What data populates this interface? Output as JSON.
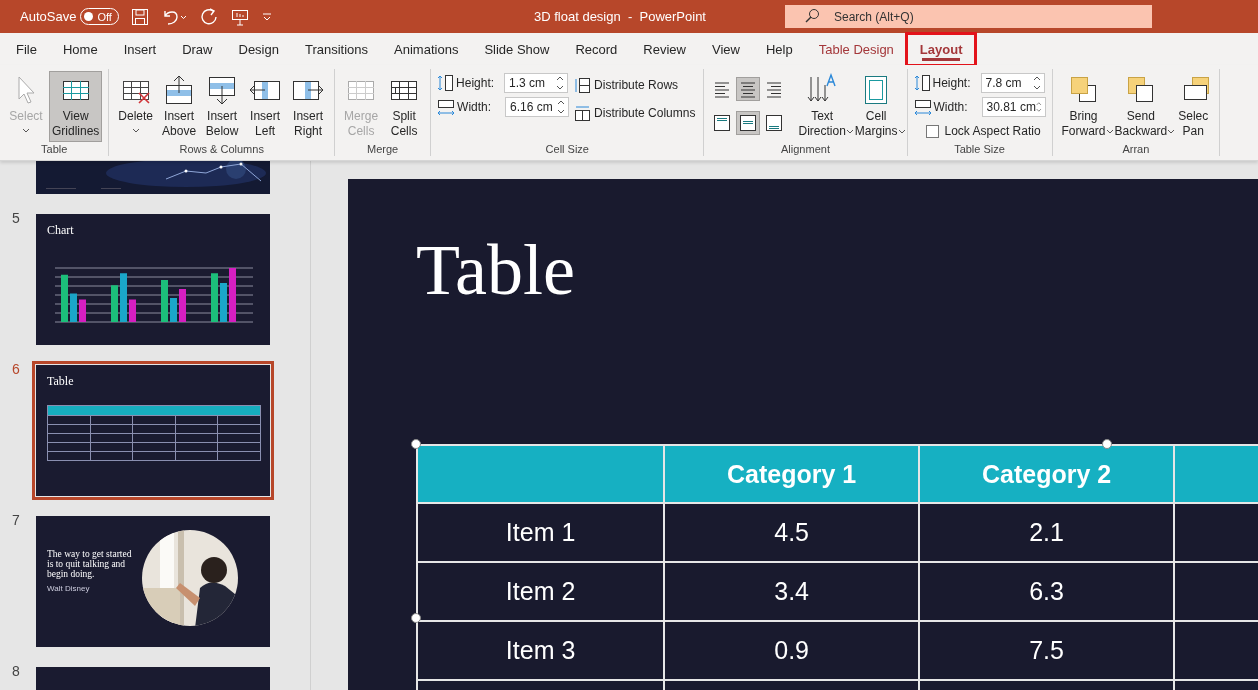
{
  "title_bar": {
    "autosave_label": "AutoSave",
    "autosave_toggle": {
      "label": "Off",
      "on": false
    },
    "document_title": "3D float design  -  PowerPoint",
    "search": {
      "placeholder": "Search (Alt+Q)"
    }
  },
  "menu_tabs": [
    {
      "label": "File",
      "selected": false,
      "kind": "plain"
    },
    {
      "label": "Home",
      "selected": false,
      "kind": "plain"
    },
    {
      "label": "Insert",
      "selected": false,
      "kind": "plain"
    },
    {
      "label": "Draw",
      "selected": false,
      "kind": "plain"
    },
    {
      "label": "Design",
      "selected": false,
      "kind": "plain"
    },
    {
      "label": "Transitions",
      "selected": false,
      "kind": "plain"
    },
    {
      "label": "Animations",
      "selected": false,
      "kind": "plain"
    },
    {
      "label": "Slide Show",
      "selected": false,
      "kind": "plain"
    },
    {
      "label": "Record",
      "selected": false,
      "kind": "plain"
    },
    {
      "label": "Review",
      "selected": false,
      "kind": "plain"
    },
    {
      "label": "View",
      "selected": false,
      "kind": "plain"
    },
    {
      "label": "Help",
      "selected": false,
      "kind": "plain"
    },
    {
      "label": "Table Design",
      "selected": false,
      "kind": "contextual"
    },
    {
      "label": "Layout",
      "selected": true,
      "kind": "contextual",
      "highlighted": true
    }
  ],
  "ribbon": [
    {
      "label": "Table",
      "items": [
        {
          "kind": "large",
          "lines": [
            "Select"
          ],
          "has_menu": true,
          "disabled": true,
          "selected": false
        },
        {
          "kind": "large",
          "lines": [
            "View",
            "Gridlines"
          ],
          "has_menu": false,
          "disabled": false,
          "selected": true
        }
      ]
    },
    {
      "label": "Rows & Columns",
      "items": [
        {
          "kind": "large",
          "lines": [
            "Delete"
          ],
          "has_menu": true,
          "disabled": false,
          "selected": false
        },
        {
          "kind": "large",
          "lines": [
            "Insert",
            "Above"
          ],
          "has_menu": false,
          "disabled": false,
          "selected": false
        },
        {
          "kind": "large",
          "lines": [
            "Insert",
            "Below"
          ],
          "has_menu": false,
          "disabled": false,
          "selected": false
        },
        {
          "kind": "large",
          "lines": [
            "Insert",
            "Left"
          ],
          "has_menu": false,
          "disabled": false,
          "selected": false
        },
        {
          "kind": "large",
          "lines": [
            "Insert",
            "Right"
          ],
          "has_menu": false,
          "disabled": false,
          "selected": false
        }
      ]
    },
    {
      "label": "Merge",
      "items": [
        {
          "kind": "large",
          "lines": [
            "Merge",
            "Cells"
          ],
          "has_menu": false,
          "disabled": true,
          "selected": false
        },
        {
          "kind": "large",
          "lines": [
            "Split",
            "Cells"
          ],
          "has_menu": false,
          "disabled": false,
          "selected": false
        }
      ]
    },
    {
      "label": "Cell Size",
      "items": [
        {
          "kind": "stack",
          "rows": [
            {
              "kind": "field",
              "label": "Height:",
              "value": "1.3 cm"
            },
            {
              "kind": "field",
              "label": "Width:",
              "value": "6.16 cm"
            }
          ]
        },
        {
          "kind": "stack",
          "rows": [
            {
              "kind": "button",
              "label": "Distribute Rows"
            },
            {
              "kind": "button",
              "label": "Distribute Columns"
            }
          ]
        }
      ]
    },
    {
      "label": "Alignment",
      "items": [
        {
          "kind": "align",
          "buttons": [
            {
              "selected": false
            },
            {
              "selected": true
            },
            {
              "selected": false
            },
            {
              "selected": false
            },
            {
              "selected": true
            },
            {
              "selected": false
            }
          ]
        },
        {
          "kind": "large",
          "lines": [
            "Text",
            "Direction"
          ],
          "has_menu": true,
          "disabled": false,
          "selected": false
        },
        {
          "kind": "large",
          "lines": [
            "Cell",
            "Margins"
          ],
          "has_menu": true,
          "disabled": false,
          "selected": false
        }
      ]
    },
    {
      "label": "Table Size",
      "items": [
        {
          "kind": "stack",
          "rows": [
            {
              "kind": "field",
              "label": "Height:",
              "value": "7.8 cm"
            },
            {
              "kind": "field",
              "label": "Width:",
              "value": "30.81 cm"
            },
            {
              "kind": "checkbox",
              "label": "Lock Aspect Ratio",
              "checked": false
            }
          ]
        }
      ]
    },
    {
      "label": "Arran",
      "items": [
        {
          "kind": "large",
          "lines": [
            "Bring",
            "Forward"
          ],
          "has_menu": true,
          "disabled": false,
          "selected": false
        },
        {
          "kind": "large",
          "lines": [
            "Send",
            "Backward"
          ],
          "has_menu": true,
          "disabled": false,
          "selected": false
        },
        {
          "kind": "large",
          "lines": [
            "Selec",
            "Pan"
          ],
          "has_menu": false,
          "disabled": false,
          "selected": false
        }
      ]
    }
  ],
  "slides": [
    {
      "kind": "stars",
      "selected": false
    },
    {
      "kind": "chart",
      "number": "5",
      "title": "Chart",
      "selected": false
    },
    {
      "kind": "table",
      "number": "6",
      "title": "Table",
      "selected": true
    },
    {
      "kind": "quote",
      "number": "7",
      "quote": "The way to get started is to quit talking and begin doing.",
      "author": "Walt Disney",
      "selected": false
    },
    {
      "kind": "blank",
      "number": "8",
      "selected": false
    }
  ],
  "slide": {
    "title": "Table",
    "table": {
      "header": [
        "Category 1",
        "Category 2"
      ],
      "rows": [
        [
          "Item 1",
          "4.5",
          "2.1"
        ],
        [
          "Item 2",
          "3.4",
          "6.3"
        ],
        [
          "Item 3",
          "0.9",
          "7.5"
        ]
      ]
    }
  }
}
